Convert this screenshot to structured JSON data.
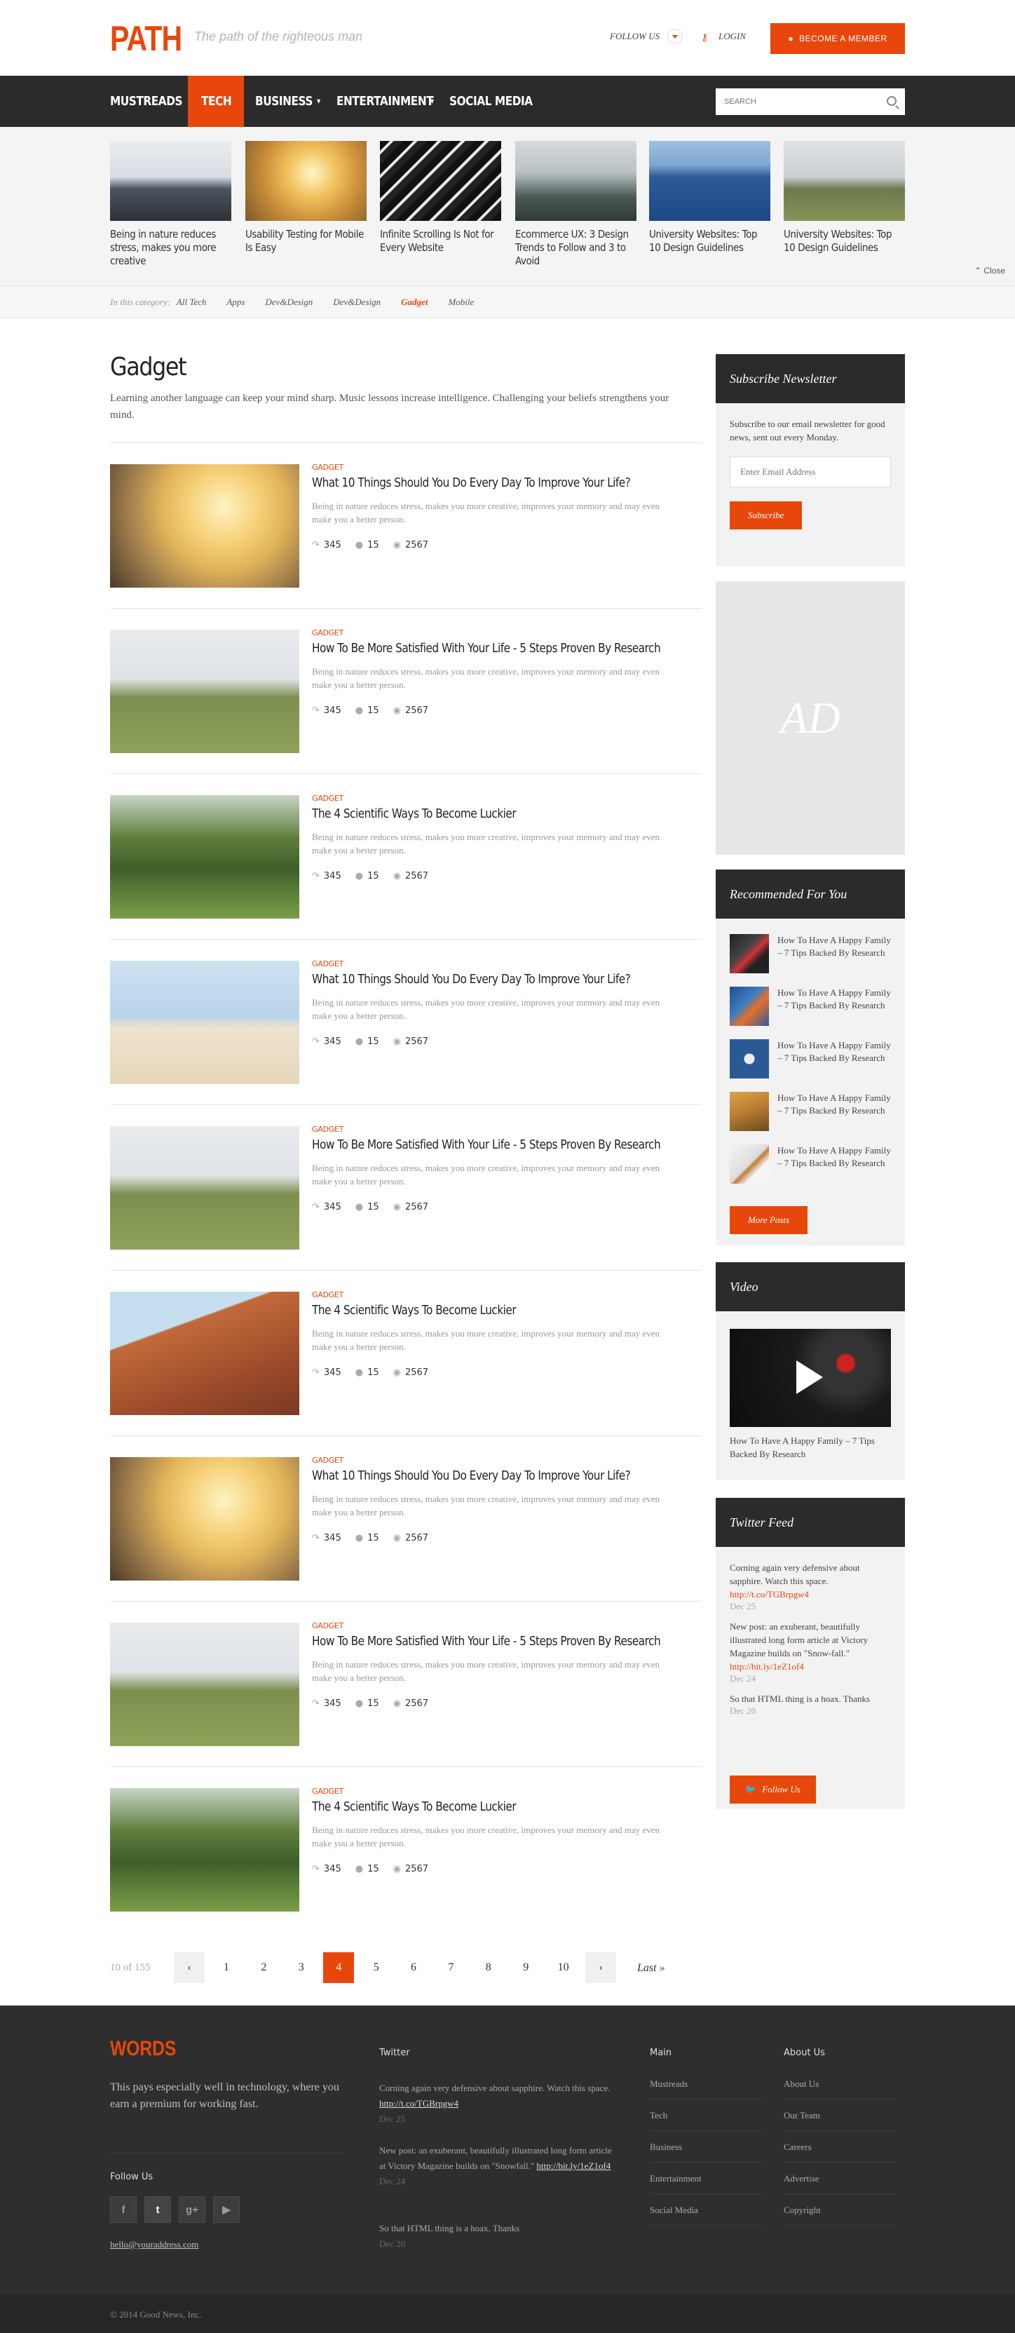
{
  "header": {
    "logo": "PATH",
    "tagline": "The path of the righteous man",
    "follow_label": "FOLLOW US",
    "login_label": "LOGIN",
    "become_label": "BECOME A MEMBER"
  },
  "nav": {
    "items": [
      "MUSTREADS",
      "TECH",
      "BUSINESS",
      "ENTERTAINMENT",
      "SOCIAL MEDIA"
    ],
    "search_placeholder": "SEARCH"
  },
  "slider": {
    "items": [
      {
        "caption": "Being in nature reduces stress, makes you more creative"
      },
      {
        "caption": "Usability Testing for Mobile Is Easy"
      },
      {
        "caption": "Infinite Scrolling Is Not for Every Website"
      },
      {
        "caption": "Ecommerce UX: 3 Design Trends to Follow and 3 to Avoid"
      },
      {
        "caption": "University Websites: Top 10 Design Guidelines"
      },
      {
        "caption": "University Websites: Top 10 Design Guidelines"
      }
    ],
    "close_label": "Close"
  },
  "category_bar": {
    "label": "In this category:",
    "items": [
      "All Tech",
      "Apps",
      "Dev&Design",
      "Dev&Design",
      "Gadget",
      "Mobile"
    ]
  },
  "main": {
    "title": "Gadget",
    "intro": "Learning another language can keep your mind sharp. Music lessons increase intelligence. Challenging your beliefs strengthens your mind.",
    "posts": [
      {
        "category": "GADGET",
        "title": "What 10 Things Should You Do Every Day To Improve Your Life?",
        "excerpt": "Being in nature reduces stress, makes you more creative, improves your memory and may even make you a better person.",
        "shares": "345",
        "comments": "15",
        "views": "2567"
      },
      {
        "category": "GADGET",
        "title": "How To Be More Satisfied With Your Life - 5 Steps Proven By Research",
        "excerpt": "Being in nature reduces stress, makes you more creative, improves your memory and may even make you a better person.",
        "shares": "345",
        "comments": "15",
        "views": "2567"
      },
      {
        "category": "GADGET",
        "title": "The 4 Scientific Ways To Become Luckier",
        "excerpt": "Being in nature reduces stress, makes you more creative, improves your memory and may even make you a better person.",
        "shares": "345",
        "comments": "15",
        "views": "2567"
      },
      {
        "category": "GADGET",
        "title": "What 10 Things Should You Do Every Day To Improve Your Life?",
        "excerpt": "Being in nature reduces stress, makes you more creative, improves your memory and may even make you a better person.",
        "shares": "345",
        "comments": "15",
        "views": "2567"
      },
      {
        "category": "GADGET",
        "title": "How To Be More Satisfied With Your Life - 5 Steps Proven By Research",
        "excerpt": "Being in nature reduces stress, makes you more creative, improves your memory and may even make you a better person.",
        "shares": "345",
        "comments": "15",
        "views": "2567"
      },
      {
        "category": "GADGET",
        "title": "The 4 Scientific Ways To Become Luckier",
        "excerpt": "Being in nature reduces stress, makes you more creative, improves your memory and may even make you a better person.",
        "shares": "345",
        "comments": "15",
        "views": "2567"
      },
      {
        "category": "GADGET",
        "title": "What 10 Things Should You Do Every Day To Improve Your Life?",
        "excerpt": "Being in nature reduces stress, makes you more creative, improves your memory and may even make you a better person.",
        "shares": "345",
        "comments": "15",
        "views": "2567"
      },
      {
        "category": "GADGET",
        "title": "How To Be More Satisfied With Your Life - 5 Steps Proven By Research",
        "excerpt": "Being in nature reduces stress, makes you more creative, improves your memory and may even make you a better person.",
        "shares": "345",
        "comments": "15",
        "views": "2567"
      },
      {
        "category": "GADGET",
        "title": "The 4 Scientific Ways To Become Luckier",
        "excerpt": "Being in nature reduces stress, makes you more creative, improves your memory and may even make you a better person.",
        "shares": "345",
        "comments": "15",
        "views": "2567"
      }
    ]
  },
  "pagination": {
    "info": "10 of 155",
    "pages": [
      "1",
      "2",
      "3",
      "4",
      "5",
      "6",
      "7",
      "8",
      "9",
      "10"
    ],
    "current": "4",
    "last_label": "Last »"
  },
  "sidebar": {
    "subscribe": {
      "title": "Subscribe Newsletter",
      "text": "Subscribe to our email newsletter for good news, sent out every Monday.",
      "placeholder": "Enter Email Address",
      "button": "Subscribe"
    },
    "ad_label": "AD",
    "recommended": {
      "title": "Recommended For You",
      "items": [
        "How To Have A Happy Family – 7 Tips Backed By Research",
        "How To Have A Happy Family – 7 Tips Backed By Research",
        "How To Have A Happy Family – 7 Tips Backed By Research",
        "How To Have A Happy Family – 7 Tips Backed By Research",
        "How To Have A Happy Family – 7 Tips Backed By Research"
      ],
      "button": "More Posts"
    },
    "video": {
      "title": "Video",
      "caption": "How To Have A Happy Family – 7 Tips Backed By Research"
    },
    "twitter": {
      "title": "Twitter Feed",
      "tweets": [
        {
          "text": "Corning again very defensive about sapphire. Watch this space. ",
          "link": "http://t.co/TGBrpgw4",
          "date": "Dec 25"
        },
        {
          "text": "New post: an exuberant, beautifully illustrated long form article at Victory Magazine builds on \"Snow-fall.\" ",
          "link": "http://bit.ly/1eZ1of4",
          "date": "Dec 24"
        },
        {
          "text": "So that HTML thing is a hoax. Thanks",
          "link": "",
          "date": "Dec 20"
        }
      ],
      "button": "Follow Us"
    }
  },
  "footer": {
    "logo": "WORDS",
    "description": "This pays especially well in technology, where you earn a premium for working fast.",
    "follow_label": "Follow Us",
    "social": [
      "f",
      "t",
      "g+",
      "yt"
    ],
    "email": "hello@youraddress.com",
    "twitter_title": "Twitter",
    "tweets": [
      {
        "text": "Corning again very defensive about sapphire. Watch this space. ",
        "link": "http://t.co/TGBrpgw4",
        "date": "Dec 25"
      },
      {
        "text": "New post: an exuberant, beautifully illustrated long form article at Victory Magazine builds on \"Snowfall.\" ",
        "link": "http://bit.ly/1eZ1of4",
        "date": "Dec 24"
      },
      {
        "text": "So that HTML thing is a hoax. Thanks",
        "link": "",
        "date": "Dec 20"
      }
    ],
    "main_title": "Main",
    "main_links": [
      "Mustreads",
      "Tech",
      "Business",
      "Entertainment",
      "Social Media"
    ],
    "about_title": "About Us",
    "about_links": [
      "About Us",
      "Our Team",
      "Careers",
      "Advertise",
      "Copyright"
    ],
    "copyright": "© 2014 Good News, Inc."
  },
  "colors": {
    "accent": "#e8470c",
    "dark": "#2b2b2b"
  }
}
